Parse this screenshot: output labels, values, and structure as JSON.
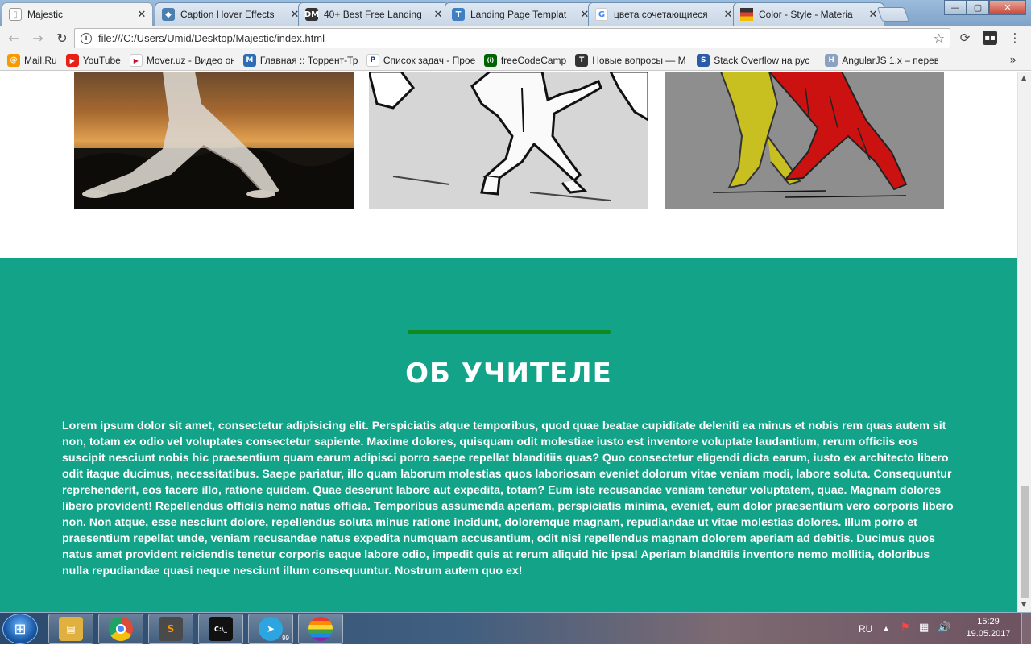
{
  "browser": {
    "tabs": [
      {
        "title": "Majestic",
        "favicon": "document-icon",
        "color": "#9a9a9a"
      },
      {
        "title": "Caption Hover Effects",
        "favicon": "drop-icon",
        "color": "#4a7fb0"
      },
      {
        "title": "40+ Best Free Landing",
        "favicon": "dm-logo-icon",
        "color": "#333333"
      },
      {
        "title": "Landing Page Templat",
        "favicon": "t-logo-icon",
        "color": "#3f7fc4"
      },
      {
        "title": "цвета сочетающиеся",
        "favicon": "google-icon",
        "color": "#4285f4"
      },
      {
        "title": "Color - Style - Materia",
        "favicon": "material-flag-icon",
        "color": "#e0b000"
      }
    ],
    "tab_close_glyph": "✕",
    "window_buttons": {
      "minimize": "—",
      "maximize": "▢",
      "close": "✕"
    },
    "url": "file:///C:/Users/Umid/Desktop/Majestic/index.html",
    "nav": {
      "back": "←",
      "forward": "→",
      "reload": "↻",
      "star": "☆",
      "sync": "⟳",
      "menu": "⋮"
    },
    "bookmarks": [
      {
        "label": "Mail.Ru",
        "icon": "mailru-icon",
        "color": "#f59a00",
        "glyph": "@"
      },
      {
        "label": "YouTube",
        "icon": "youtube-icon",
        "color": "#e62117",
        "glyph": "▶"
      },
      {
        "label": "Mover.uz - Видео онл",
        "icon": "mover-icon",
        "color": "#c8102e",
        "glyph": "▶"
      },
      {
        "label": "Главная :: Торрент-Тр",
        "icon": "torrent-icon",
        "color": "#2e6db4",
        "glyph": "M"
      },
      {
        "label": "Список задач - Прое",
        "icon": "projects-icon",
        "color": "#1c3f8a",
        "glyph": "P"
      },
      {
        "label": "freeCodeCamp",
        "icon": "freecodecamp-icon",
        "color": "#006400",
        "glyph": "(i)"
      },
      {
        "label": "Новые вопросы — M",
        "icon": "toster-icon",
        "color": "#333333",
        "glyph": "T"
      },
      {
        "label": "Stack Overflow на рус",
        "icon": "stackoverflow-icon",
        "color": "#2b5aa8",
        "glyph": "S"
      },
      {
        "label": "AngularJS 1.x – перев",
        "icon": "angular-h-icon",
        "color": "#8ca0c0",
        "glyph": "H"
      }
    ],
    "bookmarks_more": "»"
  },
  "page": {
    "about": {
      "title": "ОБ УЧИТЕЛЕ",
      "body": "Lorem ipsum dolor sit amet, consectetur adipisicing elit. Perspiciatis atque temporibus, quod quae beatae cupiditate deleniti ea minus et nobis rem quas autem sit non, totam ex odio vel voluptates consectetur sapiente. Maxime dolores, quisquam odit molestiae iusto est inventore voluptate laudantium, rerum officiis eos suscipit nesciunt nobis hic praesentium quam earum adipisci porro saepe repellat blanditiis quas? Quo consectetur eligendi dicta earum, iusto ex architecto libero odit itaque ducimus, necessitatibus. Saepe pariatur, illo quam laborum molestias quos laboriosam eveniet dolorum vitae veniam modi, labore soluta. Consequuntur reprehenderit, eos facere illo, ratione quidem. Quae deserunt labore aut expedita, totam? Eum iste recusandae veniam tenetur voluptatem, quae. Magnam dolores libero provident! Repellendus officiis nemo natus officia. Temporibus assumenda aperiam, perspiciatis minima, eveniet, eum dolor praesentium vero corporis libero non. Non atque, esse nesciunt dolore, repellendus soluta minus ratione incidunt, doloremque magnam, repudiandae ut vitae molestias dolores. Illum porro et praesentium repellat unde, veniam recusandae natus expedita numquam accusantium, odit nisi repellendus magnam dolorem aperiam ad debitis. Ducimus quos natus amet provident reiciendis tenetur corporis eaque labore odio, impedit quis at rerum aliquid hic ipsa! Aperiam blanditiis inventore nemo mollitia, doloribus nulla repudiandae quasi neque nesciunt illum consequuntur. Nostrum autem quo ex!",
      "background": "#12a389",
      "accent_rule": "#0f8a1c"
    },
    "gallery": [
      {
        "name": "tai-chi-sunset-photo"
      },
      {
        "name": "kung-fu-sketch-image"
      },
      {
        "name": "tai-chi-duo-illustration"
      }
    ]
  },
  "taskbar": {
    "start_glyph": "⊞",
    "apps": [
      {
        "name": "explorer-icon",
        "color": "#e0b040",
        "glyph": "▤"
      },
      {
        "name": "chrome-icon",
        "color": "#dd4b39",
        "glyph": "◉"
      },
      {
        "name": "sublime-text-icon",
        "color": "#4a4a4a",
        "glyph": "S"
      },
      {
        "name": "command-prompt-icon",
        "color": "#111111",
        "glyph": "C:\\_"
      },
      {
        "name": "telegram-icon",
        "color": "#2ca5e0",
        "glyph": "➤"
      },
      {
        "name": "lgbt-app-icon",
        "color": "#e040a0",
        "glyph": "●"
      }
    ],
    "telegram_badge": "99",
    "language": "RU",
    "tray": {
      "show_hidden": "▲",
      "flag": "⚑",
      "network": "▦",
      "volume": "🔊"
    },
    "time": "15:29",
    "date": "19.05.2017"
  }
}
